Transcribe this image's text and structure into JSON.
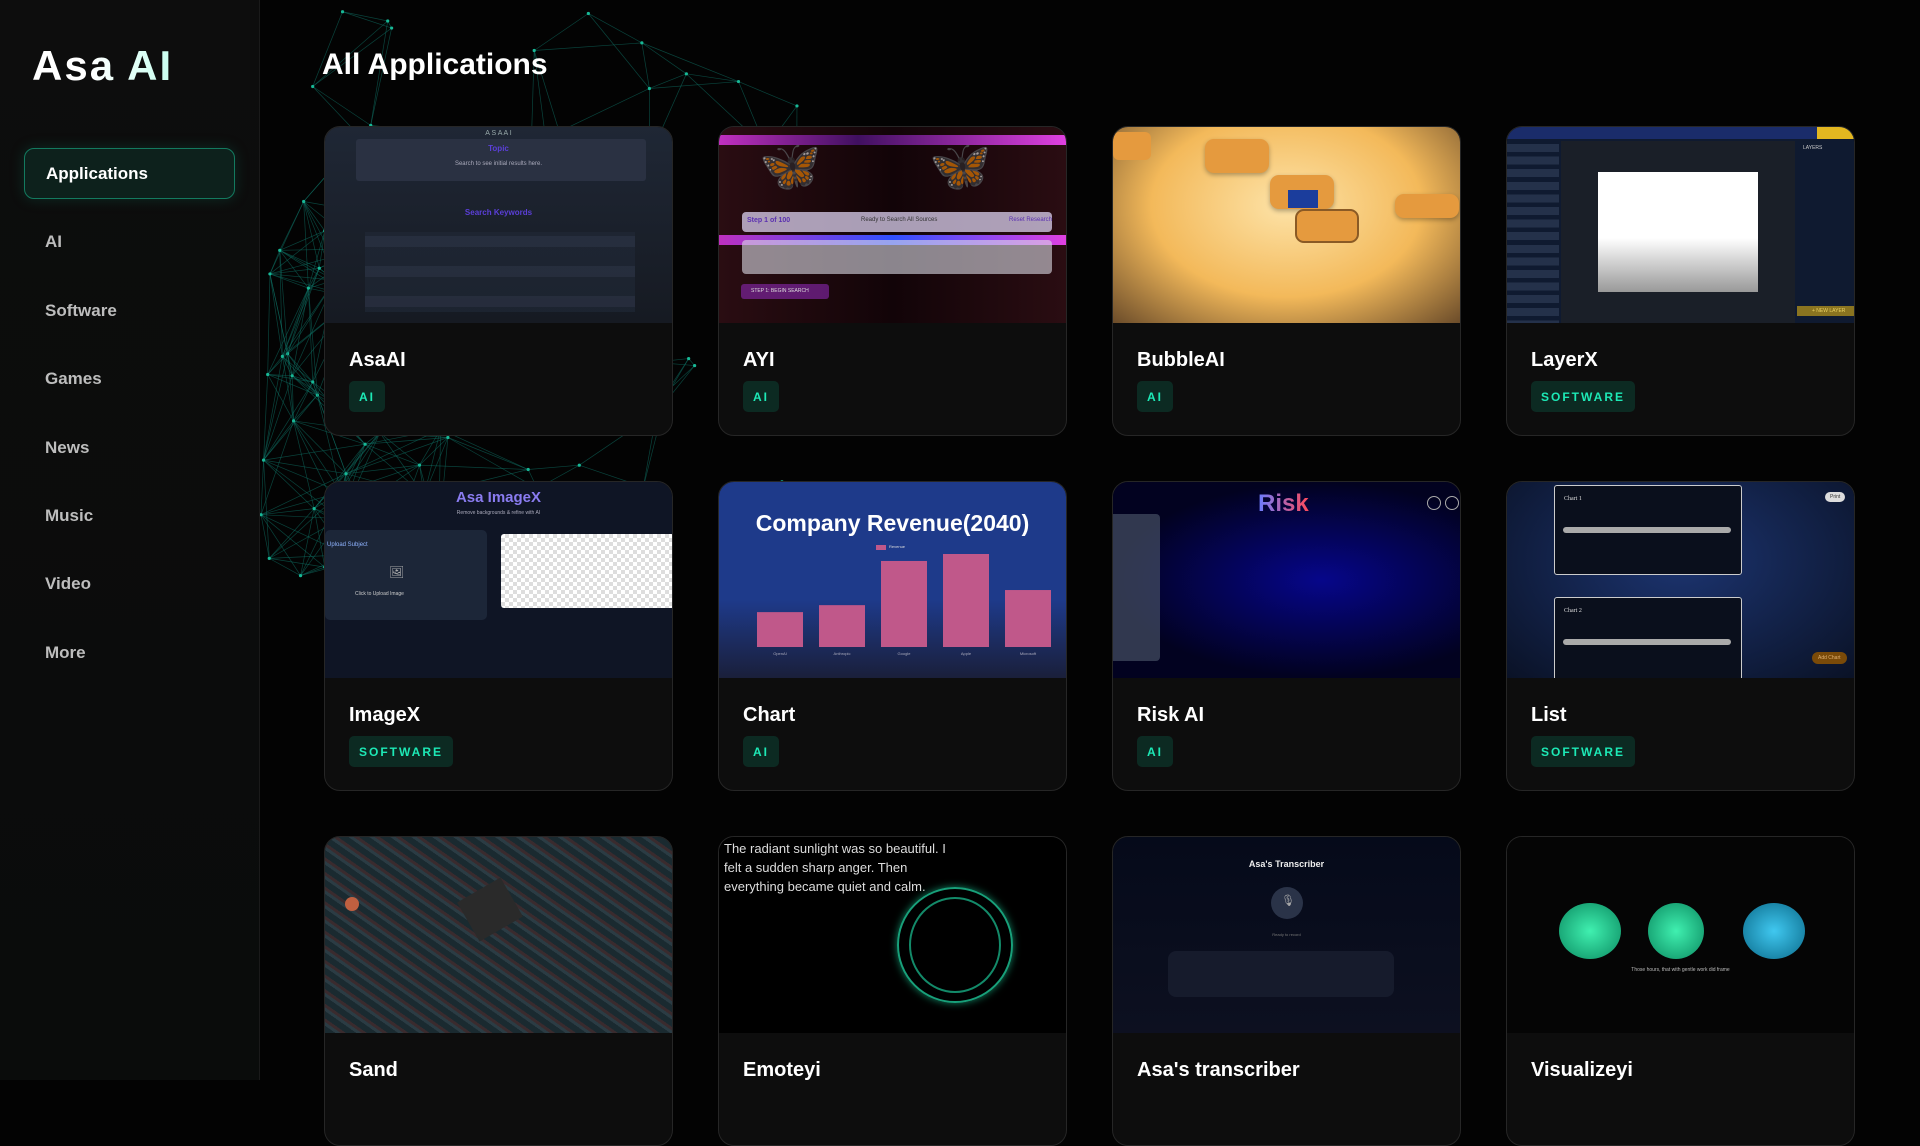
{
  "sidebar": {
    "logo": "Asa AI",
    "items": [
      {
        "label": "Applications",
        "active": true
      },
      {
        "label": "AI"
      },
      {
        "label": "Software"
      },
      {
        "label": "Games"
      },
      {
        "label": "News"
      },
      {
        "label": "Music"
      },
      {
        "label": "Video"
      },
      {
        "label": "More"
      }
    ]
  },
  "main": {
    "title": "All Applications"
  },
  "colors": {
    "accent": "#1de9b6",
    "badge_bg": "#0c2a22",
    "active_border": "#137a5f"
  },
  "cards": [
    {
      "name": "AsaAI",
      "badge": "AI"
    },
    {
      "name": "AYI",
      "badge": "AI"
    },
    {
      "name": "BubbleAI",
      "badge": "AI"
    },
    {
      "name": "LayerX",
      "badge": "SOFTWARE"
    },
    {
      "name": "ImageX",
      "badge": "SOFTWARE"
    },
    {
      "name": "Chart",
      "badge": "AI"
    },
    {
      "name": "Risk AI",
      "badge": "AI"
    },
    {
      "name": "List",
      "badge": "SOFTWARE"
    },
    {
      "name": "Sand"
    },
    {
      "name": "Emoteyi"
    },
    {
      "name": "Asa's transcriber"
    },
    {
      "name": "Visualizeyi"
    }
  ],
  "thumbs": {
    "asaai": {
      "header": "A S A   A I",
      "topic": "Topic",
      "hint": "Search to see initial results here.",
      "keywords": "Search Keywords"
    },
    "ayi": {
      "step": "Step 1 of 100",
      "status": "Ready to Search All Sources",
      "reset": "Reset Research",
      "button": "STEP 1: BEGIN SEARCH"
    },
    "layerx": {
      "layers": "LAYERS",
      "new_layer": "+ NEW LAYER"
    },
    "imagex": {
      "title": "Asa ImageX",
      "subtitle": "Remove backgrounds & refine with AI",
      "upload": "Upload Subject",
      "click": "Click to Upload Image"
    },
    "chart": {
      "title": "Company Revenue(2040)",
      "legend": "Revenue",
      "categories": [
        "OpenAI",
        "Anthropic",
        "Google",
        "Apple",
        "Microsoft"
      ],
      "values": [
        300,
        360,
        740,
        800,
        490
      ],
      "ymax": 800
    },
    "risk": {
      "title": "Risk"
    },
    "list": {
      "chart1": "Chart 1",
      "chart2": "Chart 2",
      "print": "Print",
      "add": "Add Chart"
    },
    "emoteyi": {
      "text": "The radiant sunlight was so beautiful. I felt a sudden sharp anger. Then everything became quiet and calm."
    },
    "transcriber": {
      "title": "Asa's Transcriber",
      "status": "Ready to record"
    },
    "visualizeyi": {
      "caption": "Those hours, that with gentle work did frame"
    }
  }
}
